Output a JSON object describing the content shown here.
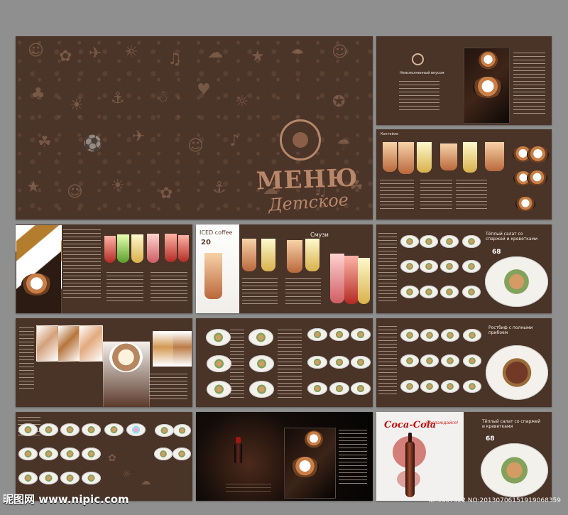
{
  "cover": {
    "title": "МЕНЮ",
    "subtitle": "Детское"
  },
  "spreads": {
    "coffee_heading": "Неисполненный вкусом",
    "iced_heading": "ICED coffee",
    "iced_price": "20",
    "smoothie_heading": "Смузи",
    "salad_heading": "Тёплый салат со спаржей и креветками",
    "salad_price": "68",
    "roast_heading": "Ростбиф с полными прибоем",
    "coke_brand": "Coca-Cola",
    "coke_slogan": "Наслаждайся!",
    "final_salad_heading": "Тёплый салат со спаржей и креветками",
    "final_salad_price": "68"
  },
  "watermark": {
    "brand": "昵图网 www.nipic.com",
    "id": "ID:5467522 NO:20130706151919068359"
  },
  "colors": {
    "background": "#8f8f8f",
    "brochure_brown": "#4a3428",
    "accent_copper": "#b88669"
  }
}
